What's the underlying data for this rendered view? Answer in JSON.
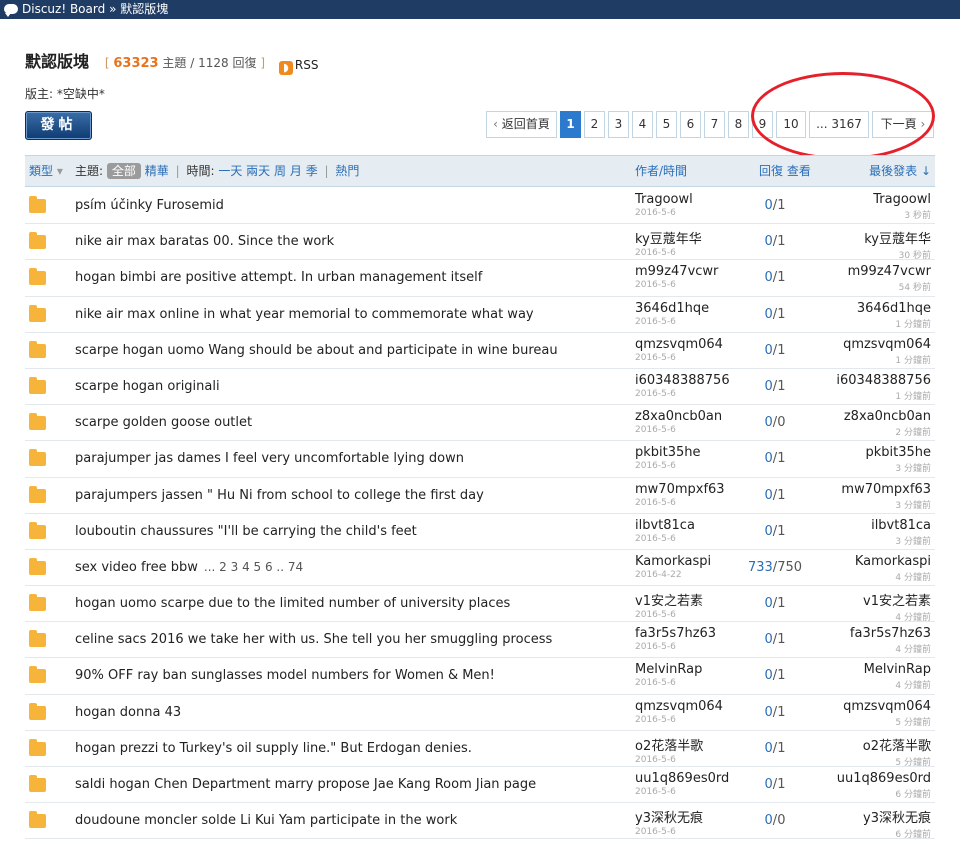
{
  "topbar": {
    "board": "Discuz! Board",
    "sep": "»",
    "forum": "默認版塊"
  },
  "forum": {
    "name": "默認版塊",
    "bracket_open": "[",
    "threads": "63323",
    "threads_label": "主題",
    "slash": "/",
    "replies": "1128",
    "replies_label": "回復",
    "bracket_close": "]",
    "rss": "RSS"
  },
  "moderator": "版主: *空缺中*",
  "post_button": "發帖",
  "pager": {
    "back": "返回首頁",
    "pages": [
      "1",
      "2",
      "3",
      "4",
      "5",
      "6",
      "7",
      "8",
      "9",
      "10"
    ],
    "current": "1",
    "last": "... 3167",
    "next": "下一頁"
  },
  "header": {
    "type": "類型",
    "topic_label": "主題:",
    "all": "全部",
    "digest": "精華",
    "time_label": "時間:",
    "times": [
      "一天",
      "兩天",
      "周",
      "月",
      "季"
    ],
    "hot": "熱門",
    "author": "作者/時間",
    "replies": "回復 查看",
    "last": "最後發表"
  },
  "threads": [
    {
      "title": "psím účinky Furosemid",
      "author": "Tragoowl",
      "date": "2016-5-6",
      "rep": "0",
      "views": "1",
      "last": "Tragoowl",
      "ago": "3 秒前"
    },
    {
      "title": "nike air max baratas 00. Since the work",
      "author": "ky豆蔻年华",
      "date": "2016-5-6",
      "rep": "0",
      "views": "1",
      "last": "ky豆蔻年华",
      "ago": "30 秒前"
    },
    {
      "title": "hogan bimbi are positive attempt. In urban management itself",
      "author": "m99z47vcwr",
      "date": "2016-5-6",
      "rep": "0",
      "views": "1",
      "last": "m99z47vcwr",
      "ago": "54 秒前"
    },
    {
      "title": "nike air max online in what year memorial to commemorate what way",
      "author": "3646d1hqe",
      "date": "2016-5-6",
      "rep": "0",
      "views": "1",
      "last": "3646d1hqe",
      "ago": "1 分鐘前"
    },
    {
      "title": "scarpe hogan uomo Wang should be about and participate in wine bureau",
      "author": "qmzsvqm064",
      "date": "2016-5-6",
      "rep": "0",
      "views": "1",
      "last": "qmzsvqm064",
      "ago": "1 分鐘前"
    },
    {
      "title": "scarpe hogan originali",
      "author": "i60348388756",
      "date": "2016-5-6",
      "rep": "0",
      "views": "1",
      "last": "i60348388756",
      "ago": "1 分鐘前"
    },
    {
      "title": "scarpe golden goose outlet",
      "author": "z8xa0ncb0an",
      "date": "2016-5-6",
      "rep": "0",
      "views": "0",
      "last": "z8xa0ncb0an",
      "ago": "2 分鐘前"
    },
    {
      "title": "parajumper jas dames I feel very uncomfortable lying down",
      "author": "pkbit35he",
      "date": "2016-5-6",
      "rep": "0",
      "views": "1",
      "last": "pkbit35he",
      "ago": "3 分鐘前"
    },
    {
      "title": "parajumpers jassen \" Hu Ni from school to college the first day",
      "author": "mw70mpxf63",
      "date": "2016-5-6",
      "rep": "0",
      "views": "1",
      "last": "mw70mpxf63",
      "ago": "3 分鐘前"
    },
    {
      "title": "louboutin chaussures \"I'll be carrying the child's feet",
      "author": "ilbvt81ca",
      "date": "2016-5-6",
      "rep": "0",
      "views": "1",
      "last": "ilbvt81ca",
      "ago": "3 分鐘前"
    },
    {
      "title": "sex video free bbw",
      "pages": "... 2  3  4  5  6 .. 74",
      "author": "Kamorkaspi",
      "date": "2016-4-22",
      "rep": "733",
      "views": "750",
      "last": "Kamorkaspi",
      "ago": "4 分鐘前"
    },
    {
      "title": "hogan uomo scarpe due to the limited number of university places",
      "author": "v1安之若素",
      "date": "2016-5-6",
      "rep": "0",
      "views": "1",
      "last": "v1安之若素",
      "ago": "4 分鐘前"
    },
    {
      "title": "celine sacs 2016 we take her with us. She tell you her smuggling process",
      "author": "fa3r5s7hz63",
      "date": "2016-5-6",
      "rep": "0",
      "views": "1",
      "last": "fa3r5s7hz63",
      "ago": "4 分鐘前"
    },
    {
      "title": "90% OFF ray ban sunglasses model numbers for Women & Men!",
      "author": "MelvinRap",
      "date": "2016-5-6",
      "rep": "0",
      "views": "1",
      "last": "MelvinRap",
      "ago": "4 分鐘前"
    },
    {
      "title": "hogan donna 43",
      "author": "qmzsvqm064",
      "date": "2016-5-6",
      "rep": "0",
      "views": "1",
      "last": "qmzsvqm064",
      "ago": "5 分鐘前"
    },
    {
      "title": "hogan prezzi to Turkey's oil supply line.\" But Erdogan denies.",
      "author": "o2花落半歌",
      "date": "2016-5-6",
      "rep": "0",
      "views": "1",
      "last": "o2花落半歌",
      "ago": "5 分鐘前"
    },
    {
      "title": "saldi hogan Chen Department marry propose Jae Kang Room Jian page",
      "author": "uu1q869es0rd",
      "date": "2016-5-6",
      "rep": "0",
      "views": "1",
      "last": "uu1q869es0rd",
      "ago": "6 分鐘前"
    },
    {
      "title": "doudoune moncler solde Li Kui Yam participate in the work",
      "author": "y3深秋无痕",
      "date": "2016-5-6",
      "rep": "0",
      "views": "0",
      "last": "y3深秋无痕",
      "ago": "6 分鐘前"
    }
  ]
}
